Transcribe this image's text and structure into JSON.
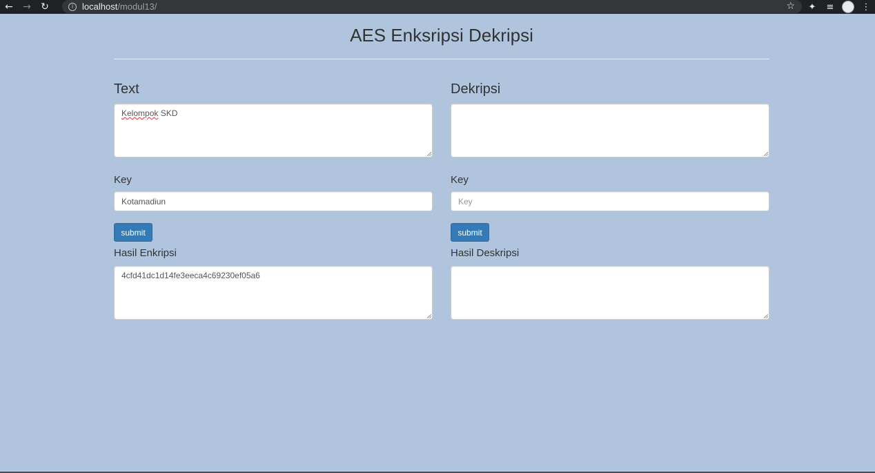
{
  "browser": {
    "url_host": "localhost",
    "url_path": "/modul13/"
  },
  "page": {
    "title": "AES Enksripsi Dekripsi"
  },
  "encrypt": {
    "heading": "Text",
    "text_value": "Kelompok SKD",
    "text_value_flagged_word": "Kelompok",
    "text_value_rest": " SKD",
    "key_label": "Key",
    "key_value": "Kotamadiun",
    "key_placeholder": "Key",
    "submit_label": "submit",
    "result_label": "Hasil Enkripsi",
    "result_value": "4cfd41dc1d14fe3eeca4c69230ef05a6"
  },
  "decrypt": {
    "heading": "Dekripsi",
    "text_value": "",
    "key_label": "Key",
    "key_value": "",
    "key_placeholder": "Key",
    "submit_label": "submit",
    "result_label": "Hasil Deskripsi",
    "result_value": ""
  },
  "colors": {
    "page_background": "#b0c4de",
    "button_primary": "#337ab7",
    "chrome_bar": "#202124"
  }
}
